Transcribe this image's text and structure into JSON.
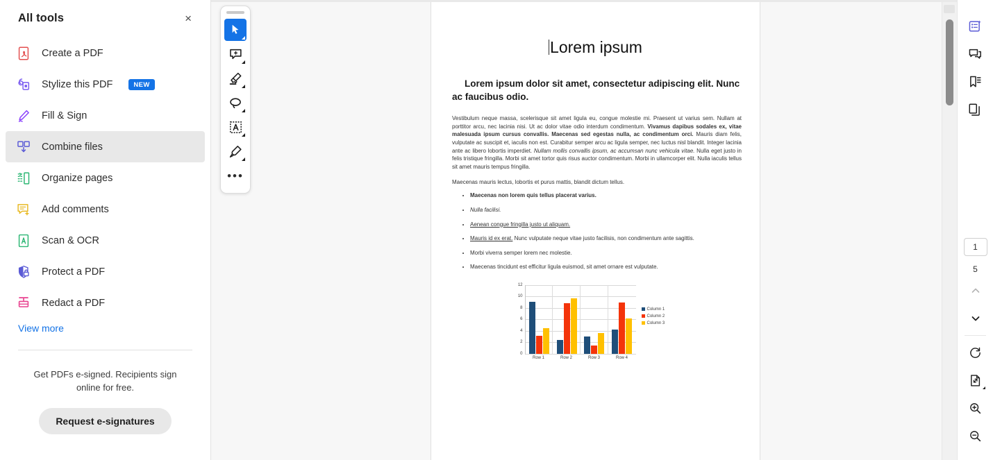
{
  "sidebar": {
    "title": "All tools",
    "close_label": "×",
    "tools": [
      {
        "label": "Create a PDF",
        "icon": "create-pdf-icon",
        "color": "#e34f4f",
        "selected": false,
        "badge": null
      },
      {
        "label": "Stylize this PDF",
        "icon": "stylize-pdf-icon",
        "color": "#7b5cf0",
        "selected": false,
        "badge": "NEW"
      },
      {
        "label": "Fill & Sign",
        "icon": "fill-and-sign-icon",
        "color": "#8a3ffc",
        "selected": false,
        "badge": null
      },
      {
        "label": "Combine files",
        "icon": "combine-files-icon",
        "color": "#5b5bd6",
        "selected": true,
        "badge": null
      },
      {
        "label": "Organize pages",
        "icon": "organize-pages-icon",
        "color": "#2bb673",
        "selected": false,
        "badge": null
      },
      {
        "label": "Add comments",
        "icon": "add-comments-icon",
        "color": "#e8b923",
        "selected": false,
        "badge": null
      },
      {
        "label": "Scan & OCR",
        "icon": "scan-ocr-icon",
        "color": "#2bb673",
        "selected": false,
        "badge": null
      },
      {
        "label": "Protect a PDF",
        "icon": "protect-pdf-icon",
        "color": "#5b5bd6",
        "selected": false,
        "badge": null
      },
      {
        "label": "Redact a PDF",
        "icon": "redact-pdf-icon",
        "color": "#e8418f",
        "selected": false,
        "badge": null
      }
    ],
    "view_more": "View more",
    "esign_blurb": "Get PDFs e-signed. Recipients sign online for free.",
    "esign_button": "Request e-signatures",
    "badge_color": "#1473e6",
    "link_color": "#1473e6"
  },
  "toolbar": {
    "accent": "#1473e6",
    "buttons": [
      {
        "name": "select-tool",
        "icon": "cursor-arrow-icon",
        "active": true,
        "has_caret": true
      },
      {
        "name": "add-comment-tool",
        "icon": "comment-plus-icon",
        "active": false,
        "has_caret": true
      },
      {
        "name": "highlight-tool",
        "icon": "highlighter-icon",
        "active": false,
        "has_caret": true
      },
      {
        "name": "draw-tool",
        "icon": "lasso-loop-icon",
        "active": false,
        "has_caret": true
      },
      {
        "name": "text-box-tool",
        "icon": "text-box-icon",
        "active": false,
        "has_caret": true
      },
      {
        "name": "fill-sign-tool",
        "icon": "pen-sign-icon",
        "active": false,
        "has_caret": true
      },
      {
        "name": "more-tools",
        "icon": "ellipsis-icon",
        "active": false,
        "has_caret": false
      }
    ],
    "more_glyph": "•••"
  },
  "document": {
    "title": "Lorem ipsum",
    "heading": "Lorem ipsum dolor sit amet, consectetur adipiscing elit. Nunc ac faucibus odio.",
    "paragraph_1_parts": [
      {
        "text": "Vestibulum neque massa, scelerisque sit amet ligula eu, congue molestie mi. Praesent ut varius sem. Nullam at porttitor arcu, nec lacinia nisi. Ut ac dolor vitae odio interdum condimentum. ",
        "style": "normal"
      },
      {
        "text": "Vivamus dapibus sodales ex, vitae malesuada ipsum cursus convallis. Maecenas sed egestas nulla, ac condimentum orci.",
        "style": "bold"
      },
      {
        "text": " Mauris diam felis, vulputate ac suscipit et, iaculis non est. Curabitur semper arcu ac ligula semper, nec luctus nisl blandit. Integer lacinia ante ac libero lobortis imperdiet. ",
        "style": "normal"
      },
      {
        "text": "Nullam mollis convallis ipsum, ac accumsan nunc vehicula vitae.",
        "style": "italic"
      },
      {
        "text": " Nulla eget justo in felis tristique fringilla. Morbi sit amet tortor quis risus auctor condimentum. Morbi in ullamcorper elit. Nulla iaculis tellus sit amet mauris tempus fringilla.",
        "style": "normal"
      }
    ],
    "paragraph_2": "Maecenas mauris lectus, lobortis et purus mattis, blandit dictum tellus.",
    "bullets": [
      {
        "text": "Maecenas non lorem quis tellus placerat varius.",
        "style": "bold"
      },
      {
        "text": "Nulla facilisi.",
        "style": "italic"
      },
      {
        "text": "Aenean congue fringilla justo ut aliquam.",
        "style": "underline"
      },
      {
        "text_underline": "Mauris id ex erat.",
        "text_rest": " Nunc vulputate neque vitae justo facilisis, non condimentum ante sagittis.",
        "style": "mixed"
      },
      {
        "text": "Morbi viverra semper lorem nec molestie.",
        "style": "normal"
      },
      {
        "text": "Maecenas tincidunt est efficitur ligula euismod, sit amet ornare est vulputate.",
        "style": "normal"
      }
    ]
  },
  "chart_data": {
    "type": "bar",
    "title": "",
    "categories": [
      "Row 1",
      "Row 2",
      "Row 3",
      "Row 4"
    ],
    "series": [
      {
        "name": "Column 1",
        "color": "#1f4e79",
        "values": [
          9.1,
          2.4,
          3.0,
          4.2
        ]
      },
      {
        "name": "Column 2",
        "color": "#f4340a",
        "values": [
          3.2,
          8.8,
          1.5,
          9.0
        ]
      },
      {
        "name": "Column 3",
        "color": "#ffc000",
        "values": [
          4.5,
          9.7,
          3.6,
          6.2
        ]
      }
    ],
    "yticks": [
      0,
      2,
      4,
      6,
      8,
      10,
      12
    ],
    "ylim": [
      0,
      12
    ],
    "xlabel": "",
    "ylabel": "",
    "grid": true,
    "legend_position": "right"
  },
  "right_rail": {
    "top_tools": [
      {
        "name": "ai-assistant-icon",
        "label": "AI assistant",
        "active": true
      },
      {
        "name": "comment-icon",
        "label": "Comment",
        "active": false
      },
      {
        "name": "bookmark-icon",
        "label": "Bookmarks",
        "active": false
      },
      {
        "name": "page-thumbnails-icon",
        "label": "Page thumbnails",
        "active": false
      }
    ],
    "current_page": "1",
    "total_pages": "5",
    "bottom_tools": [
      {
        "name": "previous-page-icon",
        "label": "Previous page"
      },
      {
        "name": "next-page-icon",
        "label": "Next page"
      },
      {
        "name": "rotate-icon",
        "label": "Rotate"
      },
      {
        "name": "fit-page-icon",
        "label": "Fit page"
      },
      {
        "name": "zoom-in-icon",
        "label": "Zoom in"
      },
      {
        "name": "zoom-out-icon",
        "label": "Zoom out"
      }
    ]
  }
}
